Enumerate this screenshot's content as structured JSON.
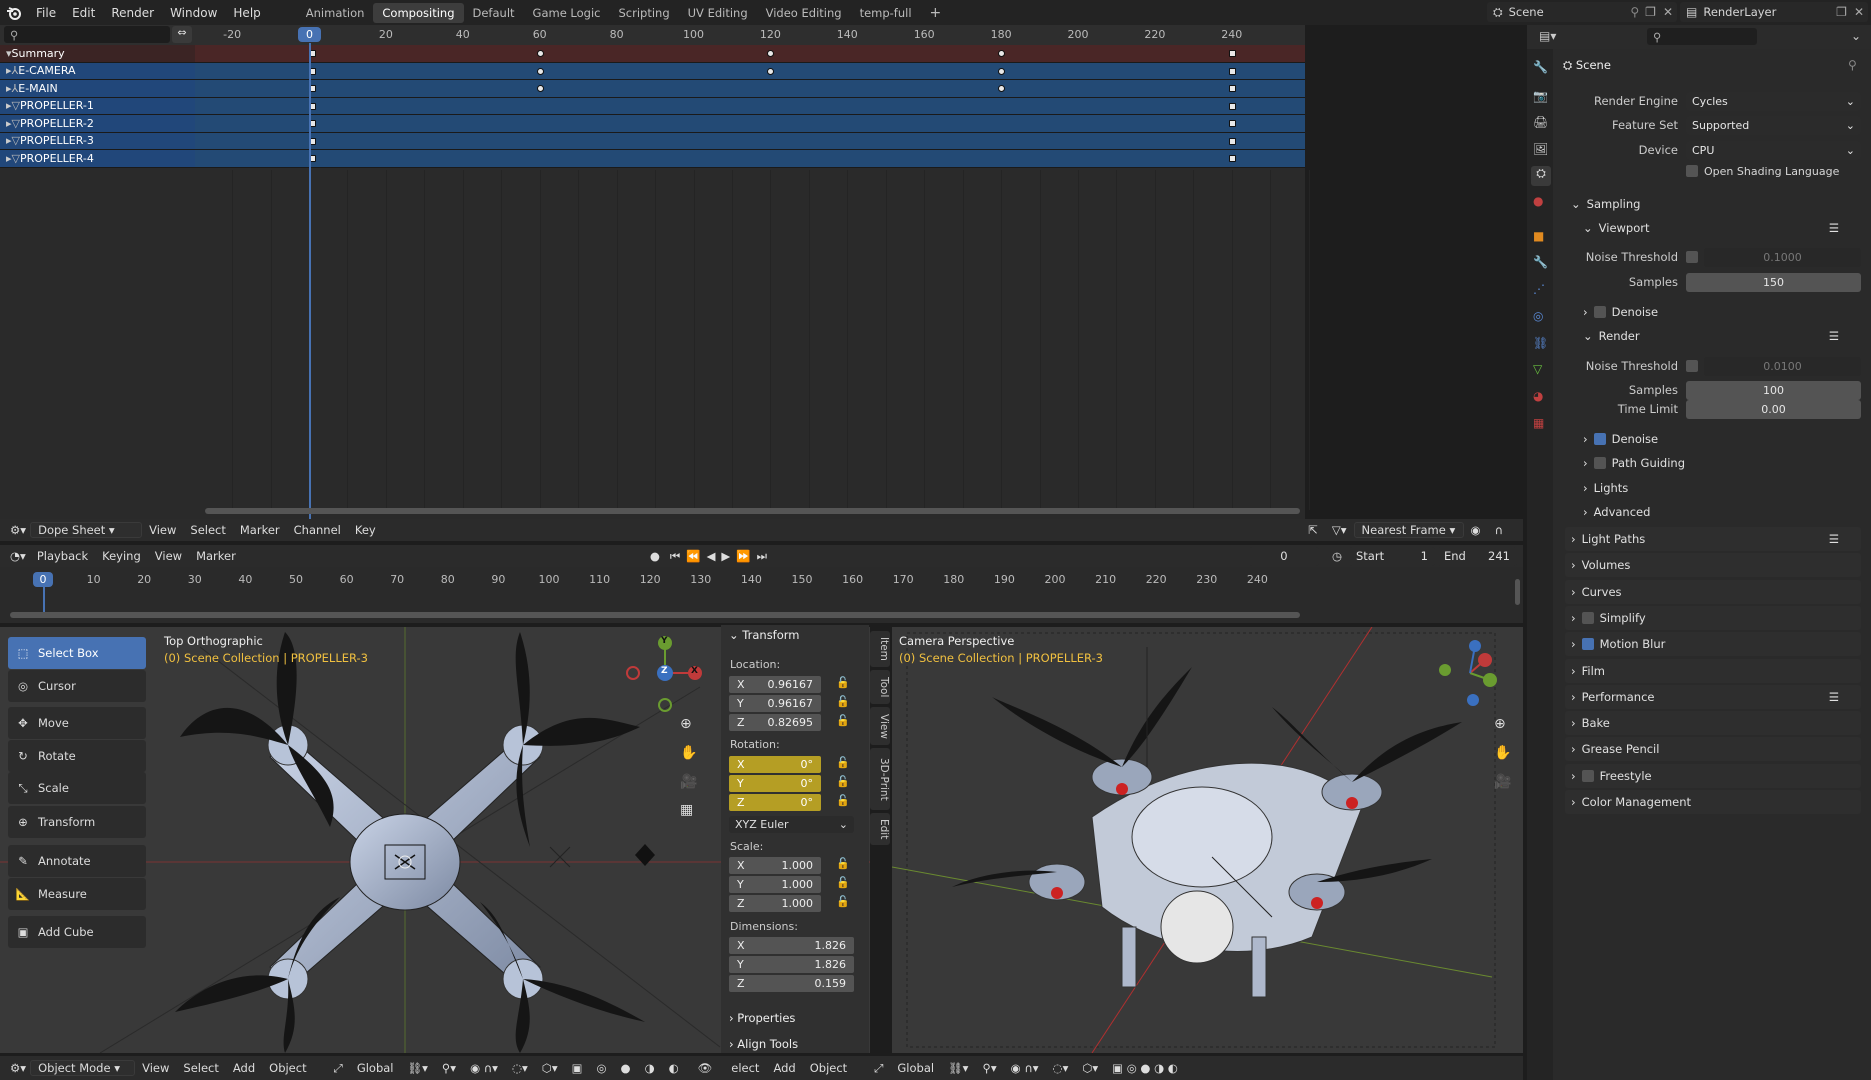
{
  "topbar": {
    "menus": [
      "File",
      "Edit",
      "Render",
      "Window",
      "Help"
    ],
    "workspaces": [
      "Animation",
      "Compositing",
      "Default",
      "Game Logic",
      "Scripting",
      "UV Editing",
      "Video Editing",
      "temp-full"
    ],
    "active_workspace": "Compositing",
    "scene": "Scene",
    "view_layer": "RenderLayer"
  },
  "dopesheet": {
    "ticks": [
      "-20",
      "0",
      "20",
      "40",
      "60",
      "80",
      "100",
      "120",
      "140",
      "160",
      "180",
      "200",
      "220",
      "240"
    ],
    "current_frame": "0",
    "channels": [
      {
        "name": "Summary",
        "kind": "summary"
      },
      {
        "name": "E-CAMERA",
        "kind": "object"
      },
      {
        "name": "E-MAIN",
        "kind": "object"
      },
      {
        "name": "PROPELLER-1",
        "kind": "mesh"
      },
      {
        "name": "PROPELLER-2",
        "kind": "mesh"
      },
      {
        "name": "PROPELLER-3",
        "kind": "mesh"
      },
      {
        "name": "PROPELLER-4",
        "kind": "mesh"
      }
    ],
    "keyframes": {
      "Summary": [
        0,
        60,
        120,
        180,
        240
      ],
      "E-CAMERA": [
        0,
        60,
        120,
        180,
        240
      ],
      "E-MAIN": [
        0,
        60,
        180,
        240
      ],
      "PROPELLER-1": [
        0,
        240
      ],
      "PROPELLER-2": [
        0,
        240
      ],
      "PROPELLER-3": [
        0,
        240
      ],
      "PROPELLER-4": [
        0,
        240
      ]
    },
    "header": {
      "mode": "Dope Sheet",
      "menus": [
        "View",
        "Select",
        "Marker",
        "Channel",
        "Key"
      ],
      "snap": "Nearest Frame"
    }
  },
  "timeline": {
    "menus": [
      "Playback",
      "Keying",
      "View",
      "Marker"
    ],
    "ticks": [
      "0",
      "10",
      "20",
      "30",
      "40",
      "50",
      "60",
      "70",
      "80",
      "90",
      "100",
      "110",
      "120",
      "130",
      "140",
      "150",
      "160",
      "170",
      "180",
      "190",
      "200",
      "210",
      "220",
      "230",
      "240"
    ],
    "current_frame": "0",
    "frame_field": "0",
    "start_label": "Start",
    "start": "1",
    "end_label": "End",
    "end": "241"
  },
  "toolbar": {
    "tools": [
      "Select Box",
      "Cursor",
      "Move",
      "Rotate",
      "Scale",
      "Transform",
      "Annotate",
      "Measure",
      "Add Cube"
    ],
    "active": "Select Box"
  },
  "viewport_left": {
    "title": "Top Orthographic",
    "collection": "(0) Scene Collection | PROPELLER-3"
  },
  "viewport_right": {
    "title": "Camera Perspective",
    "collection": "(0) Scene Collection | PROPELLER-3"
  },
  "nav_gizmo": {
    "x": "X",
    "y": "Y",
    "z": "Z"
  },
  "n_panel": {
    "header": "Transform",
    "location_label": "Location:",
    "location": {
      "x": "0.96167",
      "y": "0.96167",
      "z": "0.82695"
    },
    "rotation_label": "Rotation:",
    "rotation": {
      "x": "0°",
      "y": "0°",
      "z": "0°"
    },
    "rotation_mode": "XYZ Euler",
    "scale_label": "Scale:",
    "scale": {
      "x": "1.000",
      "y": "1.000",
      "z": "1.000"
    },
    "dimensions_label": "Dimensions:",
    "dimensions": {
      "x": "1.826",
      "y": "1.826",
      "z": "0.159"
    },
    "axes": [
      "X",
      "Y",
      "Z"
    ],
    "sections": [
      "Properties",
      "Align Tools"
    ],
    "tabs": [
      "Item",
      "Tool",
      "View",
      "3D-Print",
      "Edit"
    ]
  },
  "bottom_bar": {
    "mode": "Object Mode",
    "menus_left": [
      "View",
      "Select",
      "Add",
      "Object"
    ],
    "orientation": "Global",
    "menus_right": [
      "elect",
      "Add",
      "Object"
    ],
    "orientation_right": "Global"
  },
  "properties": {
    "context": "Scene",
    "render_engine_label": "Render Engine",
    "render_engine": "Cycles",
    "feature_set_label": "Feature Set",
    "feature_set": "Supported",
    "device_label": "Device",
    "device": "CPU",
    "osl_label": "Open Shading Language",
    "sampling": "Sampling",
    "viewport": "Viewport",
    "noise_threshold_label": "Noise Threshold",
    "viewport_noise_threshold": "0.1000",
    "samples_label": "Samples",
    "viewport_samples": "150",
    "denoise_label": "Denoise",
    "render": "Render",
    "render_noise_threshold": "0.0100",
    "render_samples": "100",
    "time_limit_label": "Time Limit",
    "time_limit": "0.00",
    "path_guiding": "Path Guiding",
    "lights": "Lights",
    "advanced": "Advanced",
    "panels": [
      "Light Paths",
      "Volumes",
      "Curves",
      "Simplify",
      "Motion Blur",
      "Film",
      "Performance",
      "Bake",
      "Grease Pencil",
      "Freestyle",
      "Color Management"
    ]
  },
  "colors": {
    "accent": "#4772b3",
    "summary_row": "#4a2626",
    "channel_row": "#234a75",
    "keyframe": "#e8e8e8",
    "playhead": "#4772b3",
    "rotation_field": "#b59e24",
    "header_yellow": "#f0c040"
  }
}
